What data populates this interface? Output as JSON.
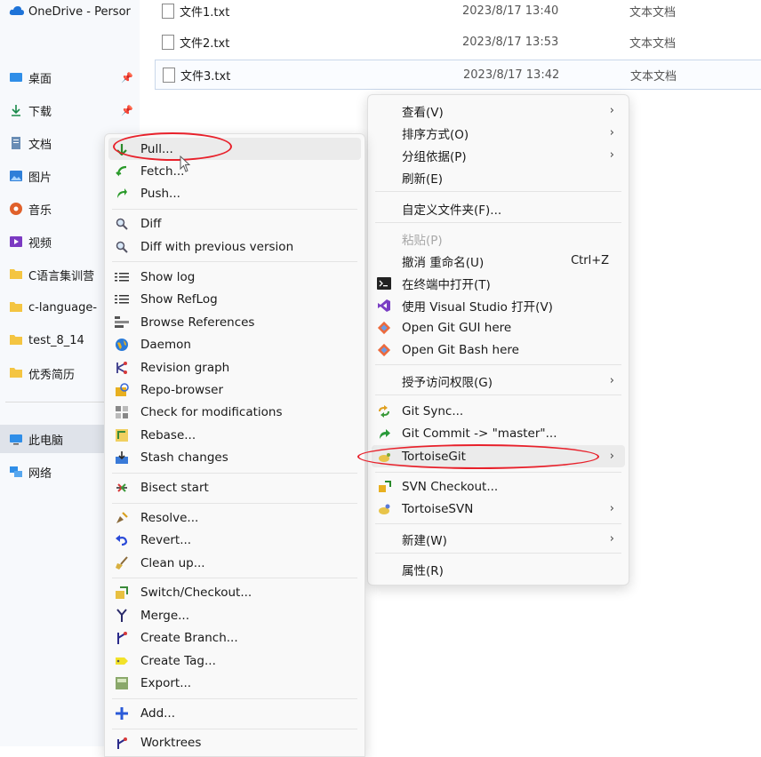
{
  "nav": {
    "onedrive": "OneDrive - Persor",
    "desktop": "桌面",
    "downloads": "下载",
    "documents": "文档",
    "pictures": "图片",
    "music": "音乐",
    "videos": "视频",
    "folder1": "C语言集训营",
    "folder2": "c-language-",
    "folder3": "test_8_14",
    "folder4": "优秀简历",
    "thispc": "此电脑",
    "network": "网络"
  },
  "files": [
    {
      "name": "文件1.txt",
      "date": "2023/8/17 13:40",
      "type": "文本文档"
    },
    {
      "name": "文件2.txt",
      "date": "2023/8/17 13:53",
      "type": "文本文档"
    },
    {
      "name": "文件3.txt",
      "date": "2023/8/17 13:42",
      "type": "文本文档"
    }
  ],
  "context_menu": {
    "view": "查看(V)",
    "sort": "排序方式(O)",
    "group": "分组依据(P)",
    "refresh": "刷新(E)",
    "customize": "自定义文件夹(F)...",
    "paste": "粘贴(P)",
    "undo": "撤消 重命名(U)",
    "undo_shortcut": "Ctrl+Z",
    "terminal": "在终端中打开(T)",
    "vs": "使用 Visual Studio 打开(V)",
    "git_gui": "Open Git GUI here",
    "git_bash": "Open Git Bash here",
    "access": "授予访问权限(G)",
    "git_sync": "Git Sync...",
    "git_commit": "Git Commit -> \"master\"...",
    "tortoisegit": "TortoiseGit",
    "svn_checkout": "SVN Checkout...",
    "tortoisesvn": "TortoiseSVN",
    "new": "新建(W)",
    "properties": "属性(R)"
  },
  "sub_menu": {
    "pull": "Pull...",
    "fetch": "Fetch...",
    "push": "Push...",
    "diff": "Diff",
    "diff_prev": "Diff with previous version",
    "show_log": "Show log",
    "show_reflog": "Show RefLog",
    "browse_refs": "Browse References",
    "daemon": "Daemon",
    "revision_graph": "Revision graph",
    "repo_browser": "Repo-browser",
    "check_mods": "Check for modifications",
    "rebase": "Rebase...",
    "stash": "Stash changes",
    "bisect": "Bisect start",
    "resolve": "Resolve...",
    "revert": "Revert...",
    "cleanup": "Clean up...",
    "switch": "Switch/Checkout...",
    "merge": "Merge...",
    "create_branch": "Create Branch...",
    "create_tag": "Create Tag...",
    "export": "Export...",
    "add": "Add...",
    "worktrees": "Worktrees"
  },
  "colors": {
    "annotation": "#e8212b",
    "menu_bg": "#f9f9f9",
    "hover": "#ebebeb"
  }
}
